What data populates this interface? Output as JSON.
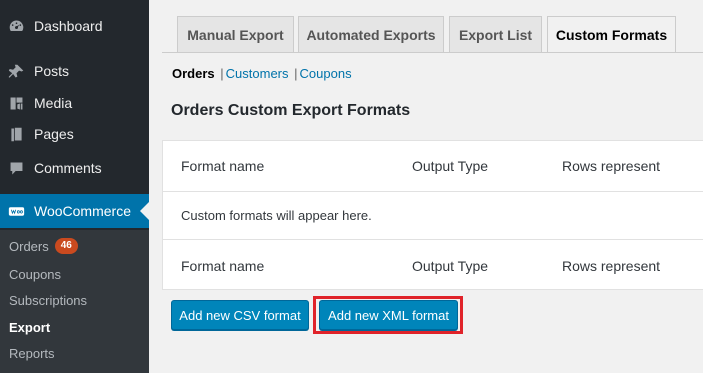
{
  "sidebar": {
    "items": [
      {
        "label": "Dashboard",
        "icon": "dashboard-icon"
      },
      {
        "label": "Posts",
        "icon": "pin-icon"
      },
      {
        "label": "Media",
        "icon": "media-icon"
      },
      {
        "label": "Pages",
        "icon": "pages-icon"
      },
      {
        "label": "Comments",
        "icon": "comments-icon"
      },
      {
        "label": "WooCommerce",
        "icon": "woocommerce-icon"
      }
    ],
    "submenu": [
      {
        "label": "Orders",
        "badge": "46"
      },
      {
        "label": "Coupons"
      },
      {
        "label": "Subscriptions"
      },
      {
        "label": "Export"
      },
      {
        "label": "Reports"
      }
    ],
    "colors": {
      "background": "#23282d",
      "active": "#0073aa",
      "badge": "#ca4a1f"
    }
  },
  "tabs": [
    {
      "label": "Manual Export"
    },
    {
      "label": "Automated Exports"
    },
    {
      "label": "Export List"
    },
    {
      "label": "Custom Formats"
    }
  ],
  "subnav": {
    "current": "Orders",
    "links": [
      "Customers",
      "Coupons"
    ],
    "separator": "|"
  },
  "heading": "Orders Custom Export Formats",
  "table": {
    "columns": [
      "Format name",
      "Output Type",
      "Rows represent"
    ],
    "empty_message": "Custom formats will appear here."
  },
  "buttons": {
    "add_csv": "Add new CSV format",
    "add_xml": "Add new XML format"
  },
  "highlight_color": "#e0232a"
}
